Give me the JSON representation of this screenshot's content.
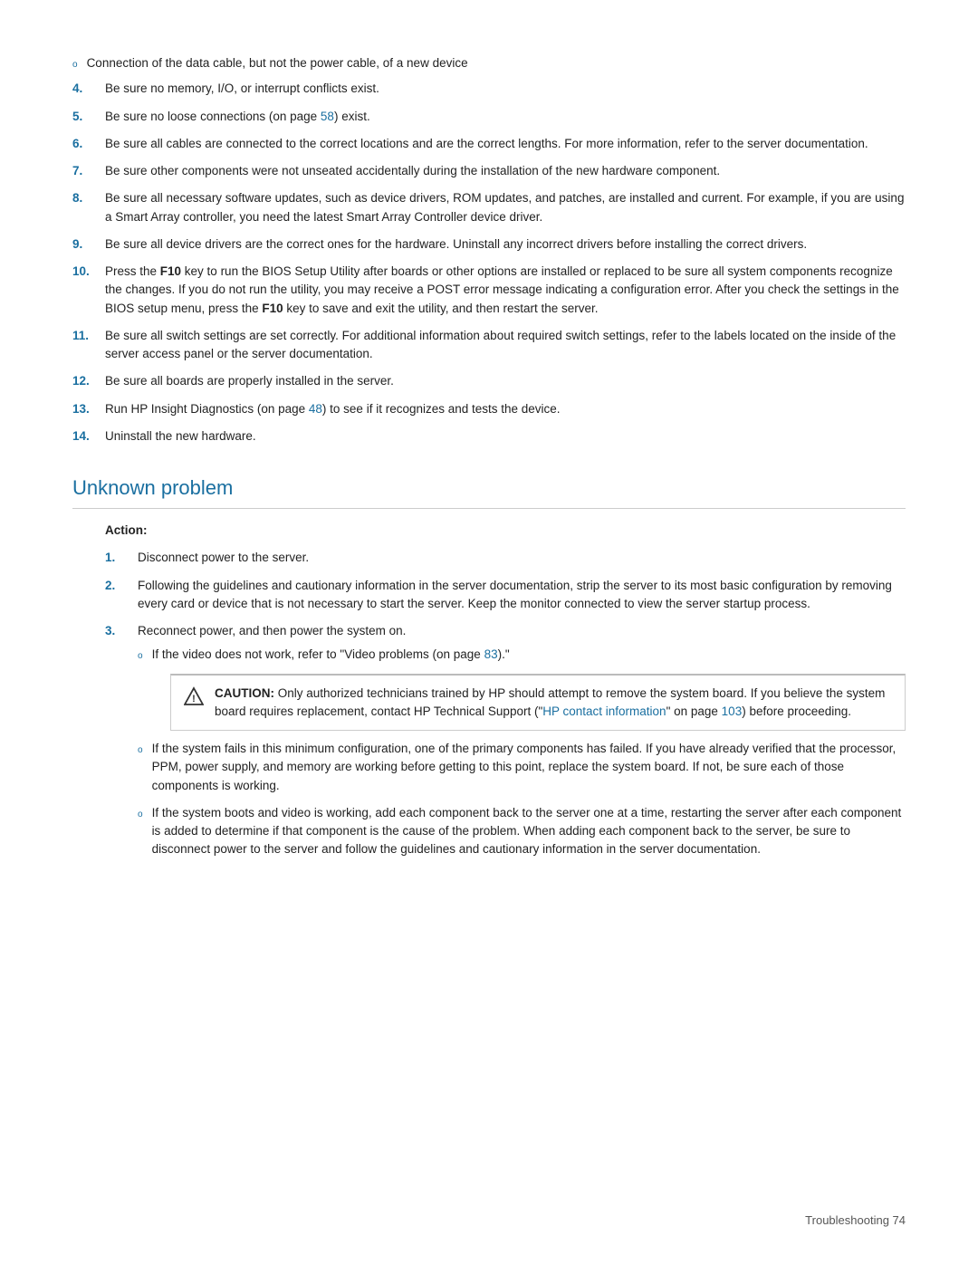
{
  "page": {
    "footer": "Troubleshooting    74"
  },
  "top_section": {
    "bullet_item": {
      "dot": "o",
      "text": "Connection of the data cable, but not the power cable, of a new device"
    },
    "numbered_items": [
      {
        "num": "4.",
        "text": "Be sure no memory, I/O, or interrupt conflicts exist."
      },
      {
        "num": "5.",
        "text_before": "Be sure no loose connections (on page ",
        "link": "58",
        "text_after": ") exist."
      },
      {
        "num": "6.",
        "text": "Be sure all cables are connected to the correct locations and are the correct lengths. For more information, refer to the server documentation."
      },
      {
        "num": "7.",
        "text": "Be sure other components were not unseated accidentally during the installation of the new hardware component."
      },
      {
        "num": "8.",
        "text": "Be sure all necessary software updates, such as device drivers, ROM updates, and patches, are installed and current. For example, if you are using a Smart Array controller, you need the latest Smart Array Controller device driver."
      },
      {
        "num": "9.",
        "text": "Be sure all device drivers are the correct ones for the hardware. Uninstall any incorrect drivers before installing the correct drivers."
      },
      {
        "num": "10.",
        "text_before": "Press the ",
        "bold": "F10",
        "text_middle": " key to run the BIOS Setup Utility after boards or other options are installed or replaced to be sure all system components recognize the changes. If you do not run the utility, you may receive a POST error message indicating a configuration error. After you check the settings in the BIOS setup menu, press the ",
        "bold2": "F10",
        "text_after": " key to save and exit the utility, and then restart the server."
      },
      {
        "num": "11.",
        "text": "Be sure all switch settings are set correctly. For additional information about required switch settings, refer to the labels located on the inside of the server access panel or the server documentation."
      },
      {
        "num": "12.",
        "text": "Be sure all boards are properly installed in the server."
      },
      {
        "num": "13.",
        "text_before": "Run HP Insight Diagnostics (on page ",
        "link": "48",
        "text_after": ") to see if it recognizes and tests the device."
      },
      {
        "num": "14.",
        "text": "Uninstall the new hardware."
      }
    ]
  },
  "unknown_problem": {
    "heading": "Unknown problem",
    "action_label": "Action:",
    "numbered_items": [
      {
        "num": "1.",
        "text": "Disconnect power to the server."
      },
      {
        "num": "2.",
        "text": "Following the guidelines and cautionary information in the server documentation, strip the server to its most basic configuration by removing every card or device that is not necessary to start the server. Keep the monitor connected to view the server startup process."
      },
      {
        "num": "3.",
        "text": "Reconnect power, and then power the system on.",
        "sub_bullet": {
          "dot": "o",
          "text_before": "If the video does not work, refer to \"Video problems (on page ",
          "link": "83",
          "text_after": ").\""
        },
        "caution": {
          "label": "CAUTION:",
          "text_before": "  Only authorized technicians trained by HP should attempt to remove the system board. If you believe the system board requires replacement, contact HP Technical Support (\"",
          "link": "HP contact information",
          "text_middle": "\" on page ",
          "link2": "103",
          "text_after": ") before proceeding."
        },
        "sub_bullets_after": [
          {
            "dot": "o",
            "text": "If the system fails in this minimum configuration, one of the primary components has failed. If you have already verified that the processor, PPM, power supply, and memory are working before getting to this point, replace the system board. If not, be sure each of those components is working."
          },
          {
            "dot": "o",
            "text": "If the system boots and video is working, add each component back to the server one at a time, restarting the server after each component is added to determine if that component is the cause of the problem. When adding each component back to the server, be sure to disconnect power to the server and follow the guidelines and cautionary information in the server documentation."
          }
        ]
      }
    ]
  }
}
